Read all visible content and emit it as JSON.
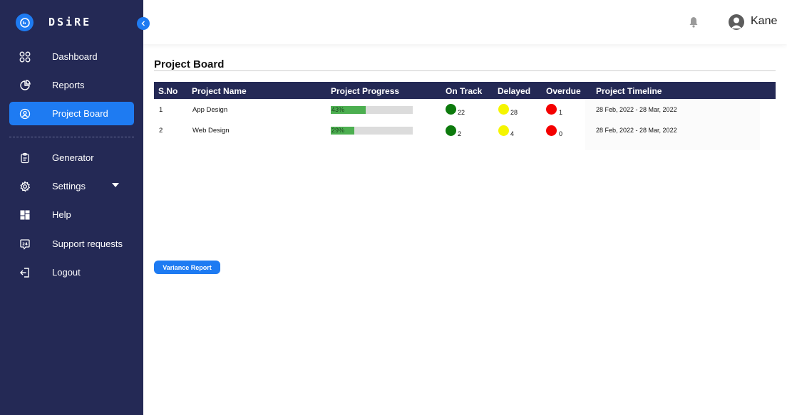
{
  "brand": {
    "name": "DSiRE",
    "accent": "#1e7bf2",
    "sidebar_bg": "#242955"
  },
  "sidebar": {
    "items": [
      {
        "label": "Dashboard",
        "icon": "grid-icon",
        "active": false
      },
      {
        "label": "Reports",
        "icon": "pie-chart-icon",
        "active": false
      },
      {
        "label": "Project Board",
        "icon": "user-badge-icon",
        "active": true
      },
      {
        "label": "Generator",
        "icon": "clipboard-icon",
        "active": false
      },
      {
        "label": "Settings",
        "icon": "gear-icon",
        "active": false,
        "has_dropdown": true
      },
      {
        "label": "Help",
        "icon": "tiles-icon",
        "active": false
      },
      {
        "label": "Support requests",
        "icon": "24h-support-icon",
        "active": false
      },
      {
        "label": "Logout",
        "icon": "logout-icon",
        "active": false
      }
    ]
  },
  "header": {
    "user_name": "Kane",
    "notification_icon": "bell-icon",
    "avatar_icon": "user-avatar-icon"
  },
  "main": {
    "title": "Project Board",
    "table": {
      "columns": [
        "S.No",
        "Project Name",
        "Project Progress",
        "On Track",
        "Delayed",
        "Overdue",
        "Project Timeline"
      ],
      "rows": [
        {
          "sno": "1",
          "name": "App Design",
          "progress": 43,
          "progress_label": "43%",
          "on_track": "22",
          "delayed": "28",
          "overdue": "1",
          "timeline": "28 Feb, 2022 - 28 Mar, 2022"
        },
        {
          "sno": "2",
          "name": "Web Design",
          "progress": 29,
          "progress_label": "29%",
          "on_track": "2",
          "delayed": "4",
          "overdue": "0",
          "timeline": "28 Feb, 2022 - 28 Mar, 2022"
        }
      ]
    },
    "variance_button": "Variance Report"
  },
  "colors": {
    "on_track": "#0d7a0d",
    "delayed": "#f5f500",
    "overdue": "#f40000",
    "progress_fill": "#4caf50"
  }
}
